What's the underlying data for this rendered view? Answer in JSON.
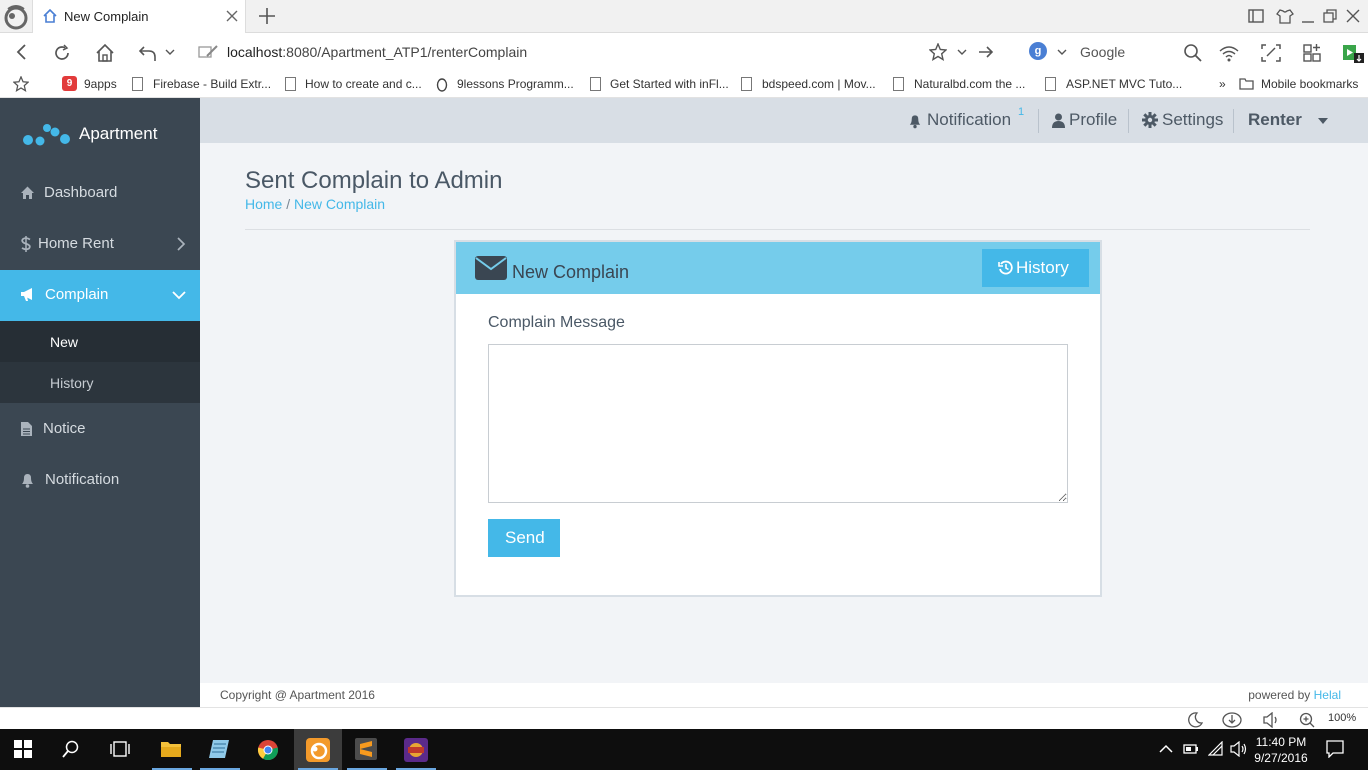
{
  "browser": {
    "tab_title": "New Complain",
    "url_host": "localhost",
    "url_rest": ":8080/Apartment_ATP1/renterComplain",
    "search_badge": "g",
    "search_engine": "Google"
  },
  "bookmarks": {
    "items": [
      "9apps",
      "Firebase - Build Extr...",
      "How to create and c...",
      "9lessons Programm...",
      "Get Started with inFl...",
      "bdspeed.com | Mov...",
      "Naturalbd.com the ...",
      "ASP.NET MVC Tuto..."
    ],
    "more": "»",
    "mobile": "Mobile bookmarks"
  },
  "app": {
    "brand": "Apartment",
    "nav": {
      "dashboard": "Dashboard",
      "home_rent": "Home Rent",
      "complain": "Complain",
      "complain_new": "New",
      "complain_history": "History",
      "notice": "Notice",
      "notification": "Notification"
    },
    "topbar": {
      "notification": "Notification",
      "notification_count": "1",
      "profile": "Profile",
      "settings": "Settings",
      "user": "Renter"
    },
    "page": {
      "title": "Sent Complain to Admin",
      "breadcrumb_home": "Home",
      "breadcrumb_sep": "/",
      "breadcrumb_current": "New Complain"
    },
    "card": {
      "title": "New Complain",
      "history_button": "History",
      "message_label": "Complain Message",
      "message_value": "",
      "send_button": "Send"
    },
    "footer": {
      "copyright": "Copyright @ Apartment 2016",
      "powered_by": "powered by",
      "author": "Helal"
    }
  },
  "statusbar": {
    "zoom": "100%"
  },
  "taskbar": {
    "time": "11:40 PM",
    "date": "9/27/2016"
  },
  "colors": {
    "accent": "#44b8e8",
    "sidebar": "#3b4752",
    "card_header": "#75cceb"
  }
}
